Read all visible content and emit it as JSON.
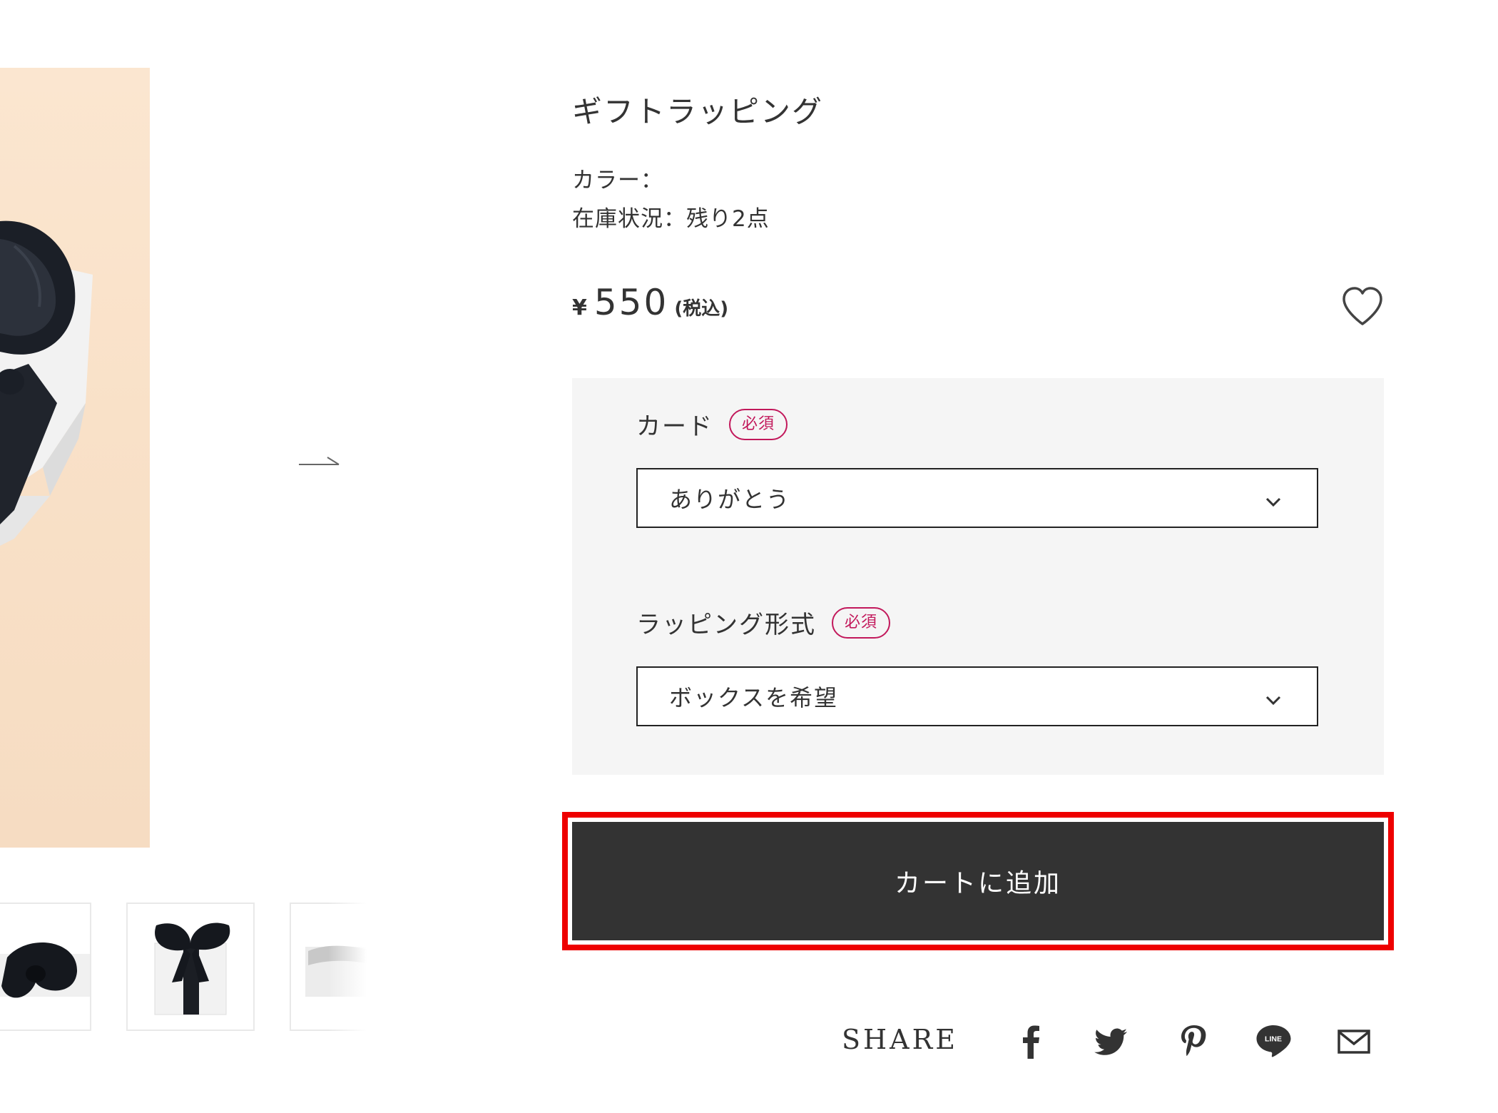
{
  "product": {
    "title": "ギフトラッピング",
    "color_label": "カラー：",
    "stock_label": "在庫状況：残り2点",
    "price": {
      "currency": "¥",
      "amount": "550",
      "tax_note": "(税込)"
    }
  },
  "options": {
    "card": {
      "label": "カード",
      "required_badge": "必須",
      "selected": "ありがとう"
    },
    "wrapping": {
      "label": "ラッピング形式",
      "required_badge": "必須",
      "selected": "ボックスを希望"
    }
  },
  "cart": {
    "add_label": "カートに追加"
  },
  "share": {
    "label": "SHARE",
    "icons": [
      "facebook-icon",
      "twitter-icon",
      "pinterest-icon",
      "line-icon",
      "mail-icon"
    ]
  },
  "colors": {
    "text": "#333333",
    "button_bg": "#333333",
    "button_text": "#ffffff",
    "options_bg": "#f5f5f5",
    "required_badge": "#c2185b",
    "highlight": "#ee0000",
    "product_image_bg": "#f9e1c8"
  }
}
